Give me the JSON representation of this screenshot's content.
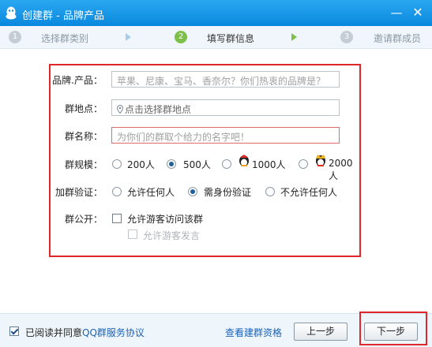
{
  "window": {
    "title": "创建群 - 品牌产品",
    "minimize_glyph": "—",
    "close_glyph": "✕"
  },
  "steps": [
    {
      "num": "1",
      "label": "选择群类别"
    },
    {
      "num": "2",
      "label": "填写群信息"
    },
    {
      "num": "3",
      "label": "邀请群成员"
    }
  ],
  "form": {
    "brand_label": "品牌.产品：",
    "brand_placeholder": "苹果、尼康、宝马、香奈尔？你们热衷的品牌是？",
    "location_label": "群地点：",
    "location_placeholder": "点击选择群地点",
    "name_label": "群名称：",
    "name_placeholder": "为你们的群取个给力的名字吧！",
    "scale_label": "群规模：",
    "scale_options": [
      "200人",
      "500人",
      "1000人",
      "2000人"
    ],
    "scale_selected": "500人",
    "verify_label": "加群验证：",
    "verify_options": [
      "允许任何人",
      "需身份验证",
      "不允许任何人"
    ],
    "verify_selected": "需身份验证",
    "public_label": "群公开：",
    "allow_visitor": "允许游客访问该群",
    "allow_visitor_speak": "允许游客发言"
  },
  "footer": {
    "agree_text": "已阅读并同意",
    "agree_link": "QQ群服务协议",
    "view_link": "查看建群资格",
    "prev_button": "上一步",
    "next_button": "下一步"
  },
  "colors": {
    "titlebar": "#0a88de",
    "highlight_red": "#e0252b",
    "active_step": "#7cc04a",
    "link": "#1a62b8"
  }
}
